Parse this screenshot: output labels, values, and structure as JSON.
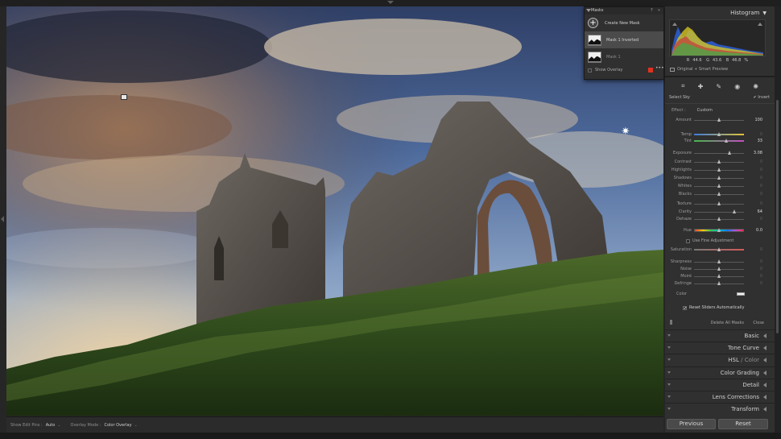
{
  "masks_panel": {
    "title": "Masks",
    "create": "Create New Mask",
    "items": [
      {
        "label": "Mask 1 Inverted"
      },
      {
        "label": "Mask 1"
      }
    ],
    "show_overlay": "Show Overlay",
    "overlay_color": "#e0321f"
  },
  "histogram": {
    "title": "Histogram",
    "r_label": "R",
    "r_value": "44.6",
    "g_label": "G",
    "g_value": "43.6",
    "b_label": "B",
    "b_value": "46.8",
    "unit": "%",
    "preview": "Original + Smart Preview"
  },
  "mask_tool": {
    "name": "Select Sky",
    "invert_label": "Invert",
    "invert_checked": true,
    "effect_label": "Effect :",
    "effect_value": "Custom",
    "sliders": [
      {
        "label": "Amount",
        "value": "100",
        "pos": 0.5,
        "active": true
      },
      {
        "label": "Temp",
        "value": "0",
        "pos": 0.5,
        "grad": "linear-gradient(to right,#3c7bd8,#e2c43a)"
      },
      {
        "label": "Tint",
        "value": "33",
        "pos": 0.66,
        "active": true,
        "grad": "linear-gradient(to right,#46b64b,#c34fc2)"
      },
      {
        "label": "Exposure",
        "value": "3.08",
        "pos": 0.72,
        "active": true
      },
      {
        "label": "Contrast",
        "value": "0",
        "pos": 0.5
      },
      {
        "label": "Highlights",
        "value": "0",
        "pos": 0.5
      },
      {
        "label": "Shadows",
        "value": "0",
        "pos": 0.5
      },
      {
        "label": "Whites",
        "value": "0",
        "pos": 0.5
      },
      {
        "label": "Blacks",
        "value": "0",
        "pos": 0.5
      },
      {
        "label": "Texture",
        "value": "0",
        "pos": 0.5
      },
      {
        "label": "Clarity",
        "value": "64",
        "pos": 0.82,
        "active": true
      },
      {
        "label": "Dehaze",
        "value": "0",
        "pos": 0.5
      },
      {
        "label": "Hue",
        "value": "0.0",
        "pos": 0.5,
        "active": true,
        "hue": true
      },
      {
        "label": "Saturation",
        "value": "0",
        "pos": 0.5,
        "grad": "linear-gradient(to right,#777,#d45a5a)"
      },
      {
        "label": "Sharpness",
        "value": "0",
        "pos": 0.5
      },
      {
        "label": "Noise",
        "value": "0",
        "pos": 0.5
      },
      {
        "label": "Moiré",
        "value": "0",
        "pos": 0.5
      },
      {
        "label": "Defringe",
        "value": "0",
        "pos": 0.5
      }
    ],
    "fine_adjust": "Use Fine Adjustment",
    "color_label": "Color",
    "reset_label": "Reset Sliders Automatically",
    "delete_all": "Delete All Masks",
    "close": "Close"
  },
  "sections": [
    {
      "label": "Basic"
    },
    {
      "label": "Tone Curve"
    },
    {
      "label": "HSL",
      "sep": " / ",
      "label2": "Color"
    },
    {
      "label": "Color Grading"
    },
    {
      "label": "Detail"
    },
    {
      "label": "Lens Corrections"
    },
    {
      "label": "Transform"
    }
  ],
  "buttons": {
    "previous": "Previous",
    "reset": "Reset"
  },
  "toolbar": {
    "edit_pins_label": "Show Edit Pins :",
    "edit_pins_value": "Auto",
    "overlay_mode_label": "Overlay Mode :",
    "overlay_mode_value": "Color Overlay"
  }
}
